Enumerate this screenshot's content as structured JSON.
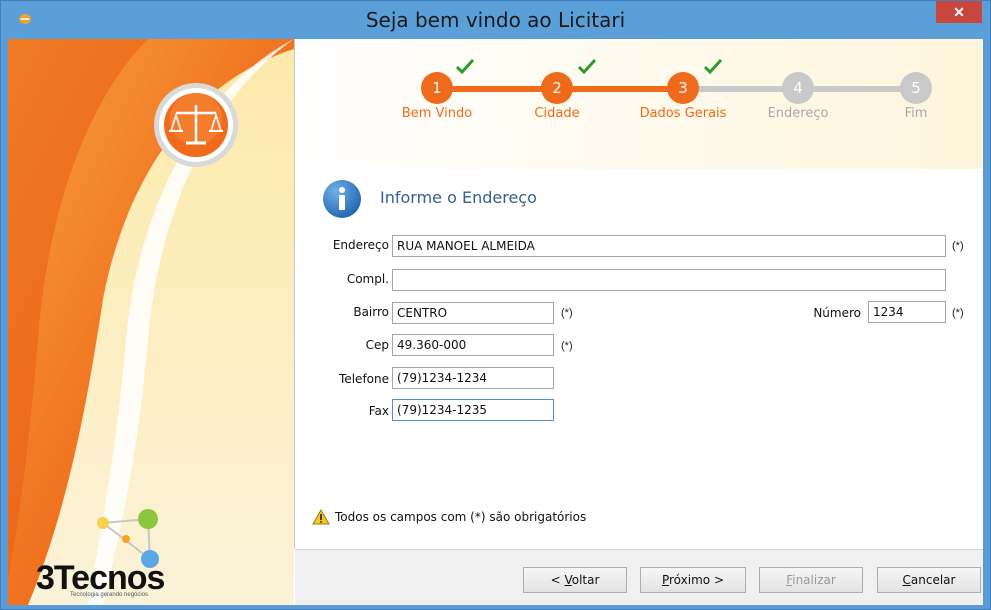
{
  "window": {
    "title": "Seja bem vindo ao Licitari",
    "close_label": "✕"
  },
  "wizard": {
    "steps": [
      {
        "number": "1",
        "label": "Bem Vindo",
        "state": "done"
      },
      {
        "number": "2",
        "label": "Cidade",
        "state": "done"
      },
      {
        "number": "3",
        "label": "Dados Gerais",
        "state": "done"
      },
      {
        "number": "4",
        "label": "Endereço",
        "state": "pending"
      },
      {
        "number": "5",
        "label": "Fim",
        "state": "pending"
      }
    ]
  },
  "form": {
    "heading": "Informe o Endereço",
    "endereco": {
      "label": "Endereço",
      "value": "RUA MANOEL ALMEIDA",
      "required": "(*)"
    },
    "compl": {
      "label": "Compl.",
      "value": ""
    },
    "bairro": {
      "label": "Bairro",
      "value": "CENTRO",
      "required": "(*)"
    },
    "numero": {
      "label": "Número",
      "value": "1234",
      "required": "(*)"
    },
    "cep": {
      "label": "Cep",
      "value": "49.360-000",
      "required": "(*)"
    },
    "telefone": {
      "label": "Telefone",
      "value": "(79)1234-1234"
    },
    "fax": {
      "label": "Fax",
      "value": "(79)1234-1235"
    }
  },
  "notice": "Todos os campos com (*) são obrigatórios",
  "buttons": {
    "voltar_pre": "< ",
    "voltar_ul": "V",
    "voltar_post": "oltar",
    "proximo_ul": "P",
    "proximo_post": "róximo >",
    "finalizar_ul": "F",
    "finalizar_post": "inalizar",
    "cancelar_ul": "C",
    "cancelar_post": "ancelar"
  },
  "brand": {
    "logo_text": "Tecnos",
    "logo_prefix": "3",
    "tagline": "Tecnologia gerando negócios"
  },
  "colors": {
    "accent_orange": "#ef6a1b",
    "pending_gray": "#c9c9c9",
    "check_green": "#2e9a2e",
    "titlebar_blue": "#5b9fd9"
  }
}
